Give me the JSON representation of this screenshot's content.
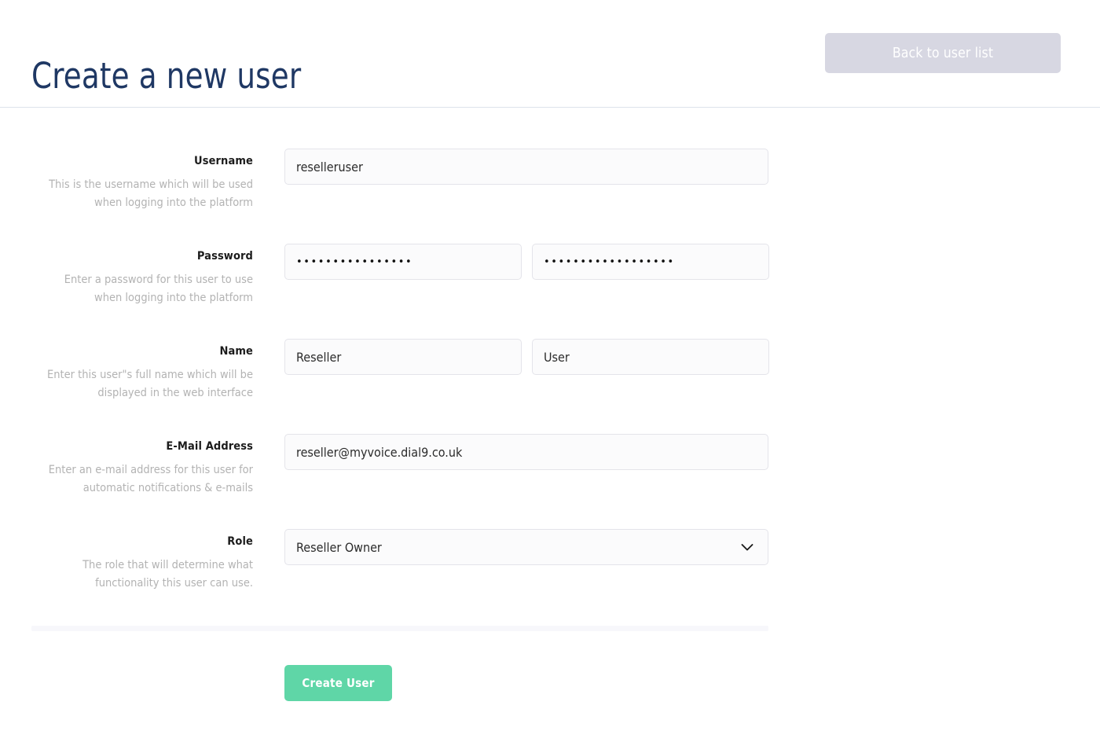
{
  "header": {
    "title": "Create a new user",
    "back_button_label": "Back to user list"
  },
  "form": {
    "fields": [
      {
        "key": "username",
        "label": "Username",
        "help": "This is the username which will be used when logging into the platform",
        "type": "text",
        "value": "reselleruser",
        "placeholder": ""
      },
      {
        "key": "password",
        "label": "Password",
        "help": "Enter a password for this user to use when logging into the platform",
        "type": "password-pair",
        "value": "••••••••••••••••",
        "value_confirm": "••••••••••••••••••",
        "placeholder": "",
        "placeholder_confirm": ""
      },
      {
        "key": "name",
        "label": "Name",
        "help": "Enter this user\"s full name which will be displayed in the web interface",
        "type": "text-pair",
        "value": "Reseller",
        "value_last": "User",
        "placeholder": "",
        "placeholder_last": ""
      },
      {
        "key": "email",
        "label": "E-Mail Address",
        "help": "Enter an e-mail address for this user for automatic notifications & e-mails",
        "type": "text",
        "value": "reseller@myvoice.dial9.co.uk",
        "placeholder": ""
      },
      {
        "key": "role",
        "label": "Role",
        "help": "The role that will determine what functionality this user can use.",
        "type": "select",
        "value": "Reseller Owner"
      }
    ],
    "submit_label": "Create User"
  },
  "colors": {
    "title": "#1f3864",
    "back_button_bg": "#d7d7e2",
    "submit_bg": "#5fd6a7",
    "input_border": "#e4e4ea",
    "input_bg": "#fbfbfc",
    "help_text": "#b3b3b3",
    "divider": "#f7f7fb",
    "header_rule": "#dde3ec"
  }
}
